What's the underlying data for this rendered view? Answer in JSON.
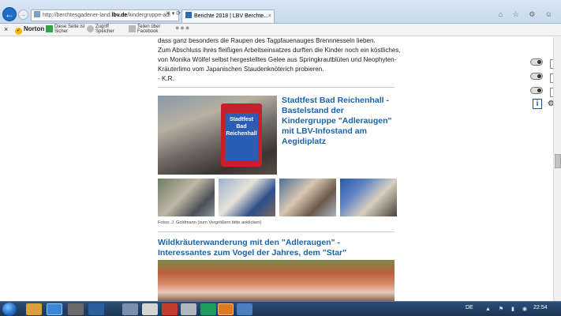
{
  "browser": {
    "url_prefix": "http://berchtesgadener-land.",
    "url_domain": "lbv.de",
    "url_suffix": "/kindergruppe-adl",
    "url_buttons": "✕ ▾ ⟳",
    "tab_active": "Berichte 2018 | LBV Berchte...",
    "tab_close": "×",
    "tab_new": "",
    "icons": "⌂ ☆ ⚙ ☺"
  },
  "toolbar": {
    "close": "×",
    "norton": "Norton",
    "safe_line1": "Diese Seite ist",
    "safe_line2": "Sicher",
    "access_line1": "Zugriff",
    "access_line2": "Speicher",
    "share_line1": "Teilen über",
    "share_line2": "Facebook",
    "more": "●●●"
  },
  "article": {
    "para_lines": [
      "dass ganz besonders die Raupen des Tagpfauenauges Brennnesseln lieben.",
      "Zum Abschluss ihres fleißigen Arbeitseinsatzes durften die Kinder noch ein köstliches,",
      "von Monika Wölfel selbst hergestelltes Gelee aus Springkrautblüten und Neophyten-",
      "Kräuterlimo vom Japanischen Staudenknöterich probieren.",
      "- K.R."
    ],
    "stadtfest_title": "Stadtfest Bad Reichenhall - Bastelstand der Kindergruppe \"Adleraugen\" mit LBV-Infostand am Aegidiplatz",
    "sign_text": "Stadtfest Bad Reichenhall",
    "caption": "Fotos: J. Goldmann (zum Vergrößern bitte anklicken)",
    "wild_title": "Wildkräuterwanderung mit den \"Adleraugen\" - Interessantes zum Vogel der Jahres, dem \"Star\""
  },
  "taskbar": {
    "lang": "DE",
    "tray": "▲ ⚑ ▮ ◉",
    "time": "22:54"
  }
}
